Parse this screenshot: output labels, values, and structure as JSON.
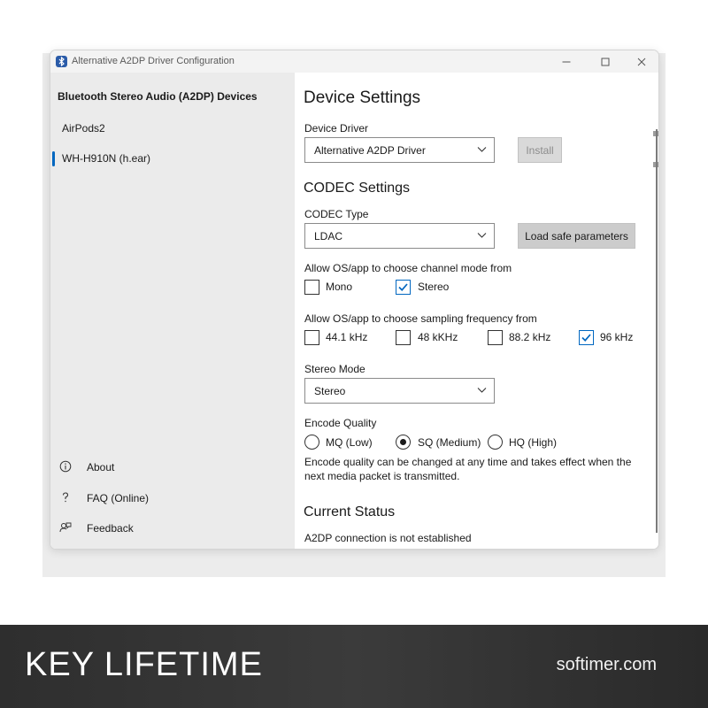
{
  "window": {
    "title": "Alternative A2DP Driver Configuration",
    "controls": {
      "minimize": "minimize-icon",
      "maximize": "maximize-icon",
      "close": "close-icon"
    }
  },
  "sidebar": {
    "header": "Bluetooth Stereo Audio (A2DP) Devices",
    "devices": [
      {
        "label": "AirPods2",
        "selected": false
      },
      {
        "label": "WH-H910N (h.ear)",
        "selected": true
      }
    ],
    "bottom": [
      {
        "label": "About",
        "icon": "info-icon"
      },
      {
        "label": "FAQ (Online)",
        "icon": "question-icon"
      },
      {
        "label": "Feedback",
        "icon": "feedback-icon"
      }
    ]
  },
  "main": {
    "title": "Device Settings",
    "device_driver": {
      "label": "Device Driver",
      "value": "Alternative A2DP Driver",
      "install_label": "Install"
    },
    "codec": {
      "heading": "CODEC Settings",
      "type_label": "CODEC Type",
      "type_value": "LDAC",
      "load_safe_label": "Load safe parameters",
      "channel_mode": {
        "label": "Allow OS/app to choose channel mode from",
        "options": [
          {
            "label": "Mono",
            "checked": false
          },
          {
            "label": "Stereo",
            "checked": true
          }
        ]
      },
      "sampling": {
        "label": "Allow OS/app to choose sampling frequency from",
        "options": [
          {
            "label": "44.1 kHz",
            "checked": false
          },
          {
            "label": "48 kKHz",
            "checked": false
          },
          {
            "label": "88.2 kHz",
            "checked": false
          },
          {
            "label": "96 kHz",
            "checked": true
          }
        ]
      },
      "stereo_mode": {
        "label": "Stereo Mode",
        "value": "Stereo"
      },
      "encode_quality": {
        "label": "Encode Quality",
        "options": [
          {
            "label": "MQ (Low)",
            "checked": false
          },
          {
            "label": "SQ (Medium)",
            "checked": true
          },
          {
            "label": "HQ (High)",
            "checked": false
          }
        ],
        "note_line1": "Encode quality can be changed at any time and takes effect when the",
        "note_line2": "next media packet is transmitted."
      }
    },
    "status": {
      "heading": "Current Status",
      "text": "A2DP connection is not established"
    }
  },
  "banner": {
    "left": "KEY LIFETIME",
    "right": "softimer.com"
  },
  "colors": {
    "accent": "#0067c0",
    "sidebar_bg": "#ebebeb",
    "banner_bg": "#333333"
  }
}
